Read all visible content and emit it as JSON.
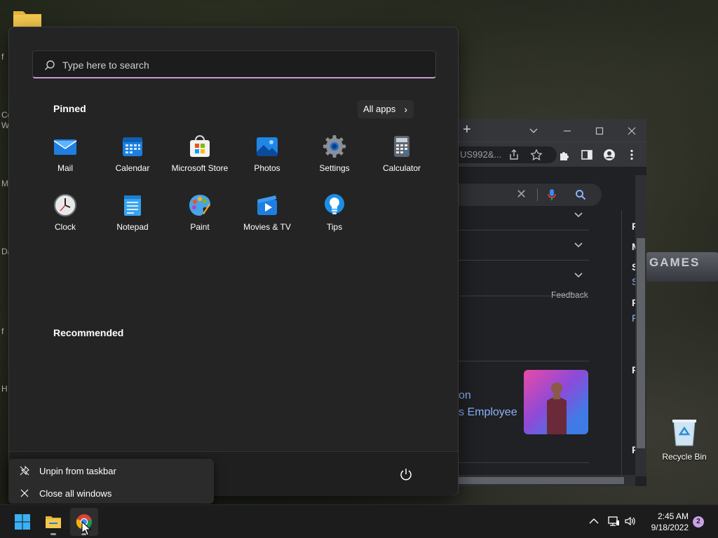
{
  "desktop": {
    "side_letters": [
      "f",
      "Co",
      "W",
      "M",
      "Da",
      "f",
      "H"
    ],
    "gamespot_text": "GAMES",
    "recycle_bin_label": "Recycle Bin"
  },
  "browser": {
    "url_fragment": "US992&...",
    "feedback_label": "Feedback",
    "news_line1": "on",
    "news_line2": "s Employee",
    "right_col_letters": [
      "R",
      "M",
      "S",
      "F",
      "R",
      "R"
    ],
    "right_col_links": [
      "S",
      "F"
    ]
  },
  "start_menu": {
    "search_placeholder": "Type here to search",
    "pinned_title": "Pinned",
    "all_apps_label": "All apps",
    "recommended_title": "Recommended",
    "pinned_apps": [
      {
        "label": "Mail",
        "icon": "mail-icon"
      },
      {
        "label": "Calendar",
        "icon": "calendar-icon"
      },
      {
        "label": "Microsoft Store",
        "icon": "store-icon"
      },
      {
        "label": "Photos",
        "icon": "photos-icon"
      },
      {
        "label": "Settings",
        "icon": "settings-icon"
      },
      {
        "label": "Calculator",
        "icon": "calculator-icon"
      },
      {
        "label": "Clock",
        "icon": "clock-icon"
      },
      {
        "label": "Notepad",
        "icon": "notepad-icon"
      },
      {
        "label": "Paint",
        "icon": "paint-icon"
      },
      {
        "label": "Movies & TV",
        "icon": "movies-icon"
      },
      {
        "label": "Tips",
        "icon": "tips-icon"
      }
    ]
  },
  "jump_list": {
    "unpin_label": "Unpin from taskbar",
    "close_all_label": "Close all windows"
  },
  "taskbar": {
    "time": "2:45 AM",
    "date": "9/18/2022",
    "notification_count": "2"
  },
  "colors": {
    "accent": "#c49bd2",
    "start_bg": "#242424",
    "taskbar_bg": "#1c1c1c",
    "link_blue": "#8ab4f8"
  }
}
